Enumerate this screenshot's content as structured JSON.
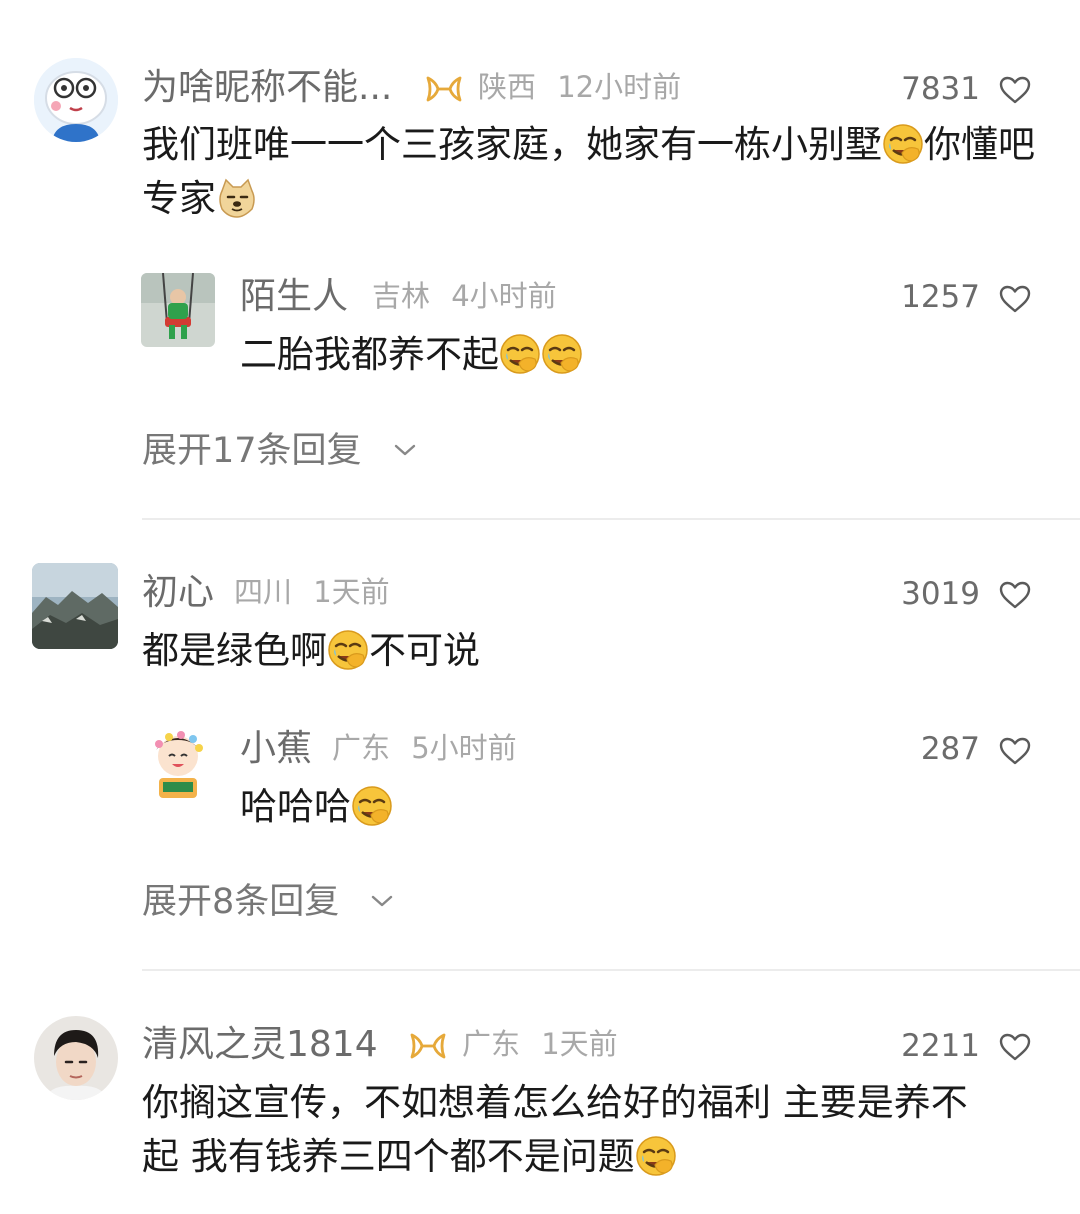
{
  "comments": [
    {
      "name": "为啥昵称不能...",
      "location": "陕西",
      "time": "12小时前",
      "likes": "7831",
      "content_a": "我们班唯一一个三孩家庭，她家有一栋小别墅",
      "content_b": "你懂吧专家",
      "avatar_icon": "cartoon-sheep-icon",
      "reply": {
        "name": "陌生人",
        "location": "吉林",
        "time": "4小时前",
        "likes": "1257",
        "content": "二胎我都养不起"
      },
      "expand_label": "展开17条回复"
    },
    {
      "name": "初心",
      "location": "四川",
      "time": "1天前",
      "likes": "3019",
      "content_a": "都是绿色啊",
      "content_b": "不可说",
      "reply": {
        "name": "小蕉",
        "location": "广东",
        "time": "5小时前",
        "likes": "287",
        "content": "哈哈哈"
      },
      "expand_label": "展开8条回复"
    },
    {
      "name": "清风之灵1814",
      "location": "广东",
      "time": "1天前",
      "likes": "2211",
      "content_line1": "你搁这宣传，不如想着怎么给好的福利 主要是养不",
      "content_line2": "起 我有钱养三四个都不是问题"
    }
  ],
  "colors": {
    "text": "#1a1a1a",
    "name": "#6b6b6b",
    "meta": "#a8a8a8",
    "badge": "#e6a93a",
    "divider": "#ececec"
  },
  "icons": {
    "like": "heart-outline-icon",
    "emoji": "facepalm-laugh-emoji",
    "dog_emoji": "doge-emoji",
    "badge": "gold-ribbon-badge-icon",
    "expand": "chevron-down-icon"
  }
}
